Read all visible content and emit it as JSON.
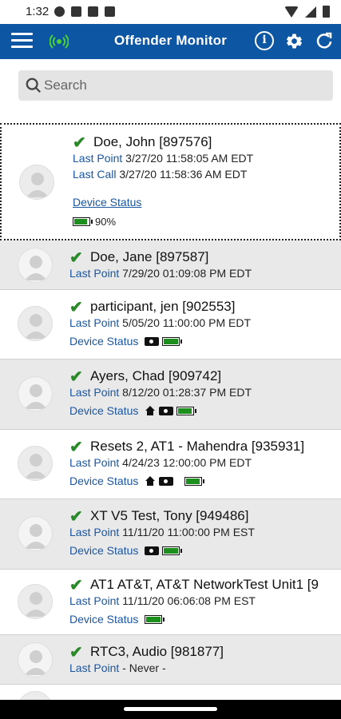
{
  "status_bar": {
    "time": "1:32"
  },
  "app_bar": {
    "title": "Offender Monitor"
  },
  "search": {
    "placeholder": "Search"
  },
  "selected": {
    "name": "Doe, John [897576]",
    "last_point_label": "Last Point",
    "last_point": "3/27/20 11:58:05 AM EDT",
    "last_call_label": "Last Call",
    "last_call": "3/27/20 11:58:36 AM EDT",
    "device_status_label": "Device Status",
    "battery_percent": "90%",
    "battery_level": 0.9
  },
  "rows": [
    {
      "name": "Doe, Jane [897587]",
      "last_point_label": "Last Point",
      "last_point": "7/29/20 01:09:08 PM EDT"
    },
    {
      "name": "participant, jen [902553]",
      "last_point_label": "Last Point",
      "last_point": "5/05/20 11:00:00 PM EDT",
      "device_status_label": "Device Status"
    },
    {
      "name": "Ayers, Chad [909742]",
      "last_point_label": "Last Point",
      "last_point": "8/12/20 01:28:37 PM EDT",
      "device_status_label": "Device Status"
    },
    {
      "name": "Resets 2, AT1 - Mahendra [935931]",
      "last_point_label": "Last Point",
      "last_point": "4/24/23 12:00:00 PM EDT",
      "device_status_label": "Device Status"
    },
    {
      "name": "XT V5 Test, Tony [949486]",
      "last_point_label": "Last Point",
      "last_point": "11/11/20 11:00:00 PM EST",
      "device_status_label": "Device Status"
    },
    {
      "name": "AT1 AT&T, AT&T NetworkTest Unit1 [9",
      "last_point_label": "Last Point",
      "last_point": "11/11/20 06:06:08 PM EST",
      "device_status_label": "Device Status"
    },
    {
      "name": "RTC3, Audio [981877]",
      "last_point_label": "Last Point",
      "last_point": " - Never -"
    }
  ],
  "colors": {
    "app_bar": "#0d56a3",
    "check": "#2a8a2a",
    "battery": "#1c8f1c",
    "label": "#1a56a0"
  }
}
